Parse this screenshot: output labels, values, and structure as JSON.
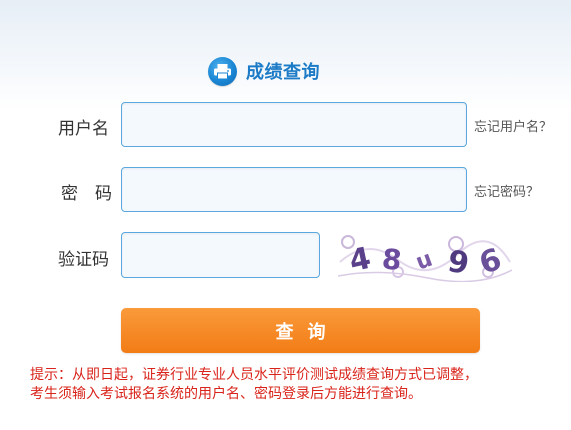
{
  "header": {
    "icon": "printer-icon",
    "title": "成绩查询",
    "title_color": "#1c7bc6"
  },
  "form": {
    "username": {
      "label": "用户名",
      "value": "",
      "help_link": "忘记用户名？"
    },
    "password": {
      "label": "密　码",
      "value": "",
      "help_link": "忘记密码？"
    },
    "captcha": {
      "label": "验证码",
      "value": "",
      "image_glyphs": [
        "4",
        "8",
        "u",
        "9",
        "6"
      ]
    },
    "submit_label": "查询",
    "submit_color": "#f58220"
  },
  "notice": {
    "line1": "提示：从即日起，证券行业专业人员水平评价测试成绩查询方式已调整，",
    "line2": "考生须输入考试报名系统的用户名、密码登录后方能进行查询。",
    "color": "#d9241b"
  }
}
